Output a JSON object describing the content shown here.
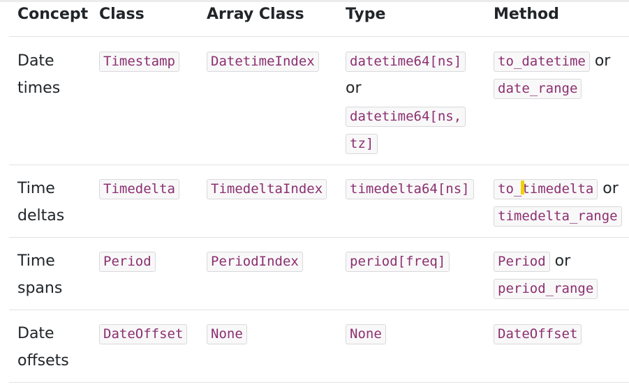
{
  "table": {
    "headers": [
      "Concept",
      "Class",
      "Array Class",
      "Type",
      "Method"
    ],
    "rows": [
      {
        "concept": "Date times",
        "class": "Timestamp",
        "array_class": "DatetimeIndex",
        "type": [
          "datetime64[ns]",
          "or",
          "datetime64[ns, tz]"
        ],
        "method": [
          "to_datetime",
          "or",
          "date_range"
        ]
      },
      {
        "concept": "Time deltas",
        "class": "Timedelta",
        "array_class": "TimedeltaIndex",
        "type": [
          "timedelta64[ns]"
        ],
        "method": [
          "to_timedelta",
          "or",
          "timedelta_range"
        ]
      },
      {
        "concept": "Time spans",
        "class": "Period",
        "array_class": "PeriodIndex",
        "type": [
          "period[freq]"
        ],
        "method": [
          "Period",
          "or",
          "period_range"
        ]
      },
      {
        "concept": "Date offsets",
        "class": "DateOffset",
        "array_class": "None",
        "type": [
          "None"
        ],
        "method": [
          "DateOffset"
        ]
      }
    ]
  },
  "colors": {
    "code_text": "#8c2f6f",
    "code_bg": "#f8f8f9",
    "code_border": "#d9d9dc",
    "body_text": "#212529",
    "row_border": "#dee2e6",
    "cursor_highlight": "#f2d100"
  }
}
